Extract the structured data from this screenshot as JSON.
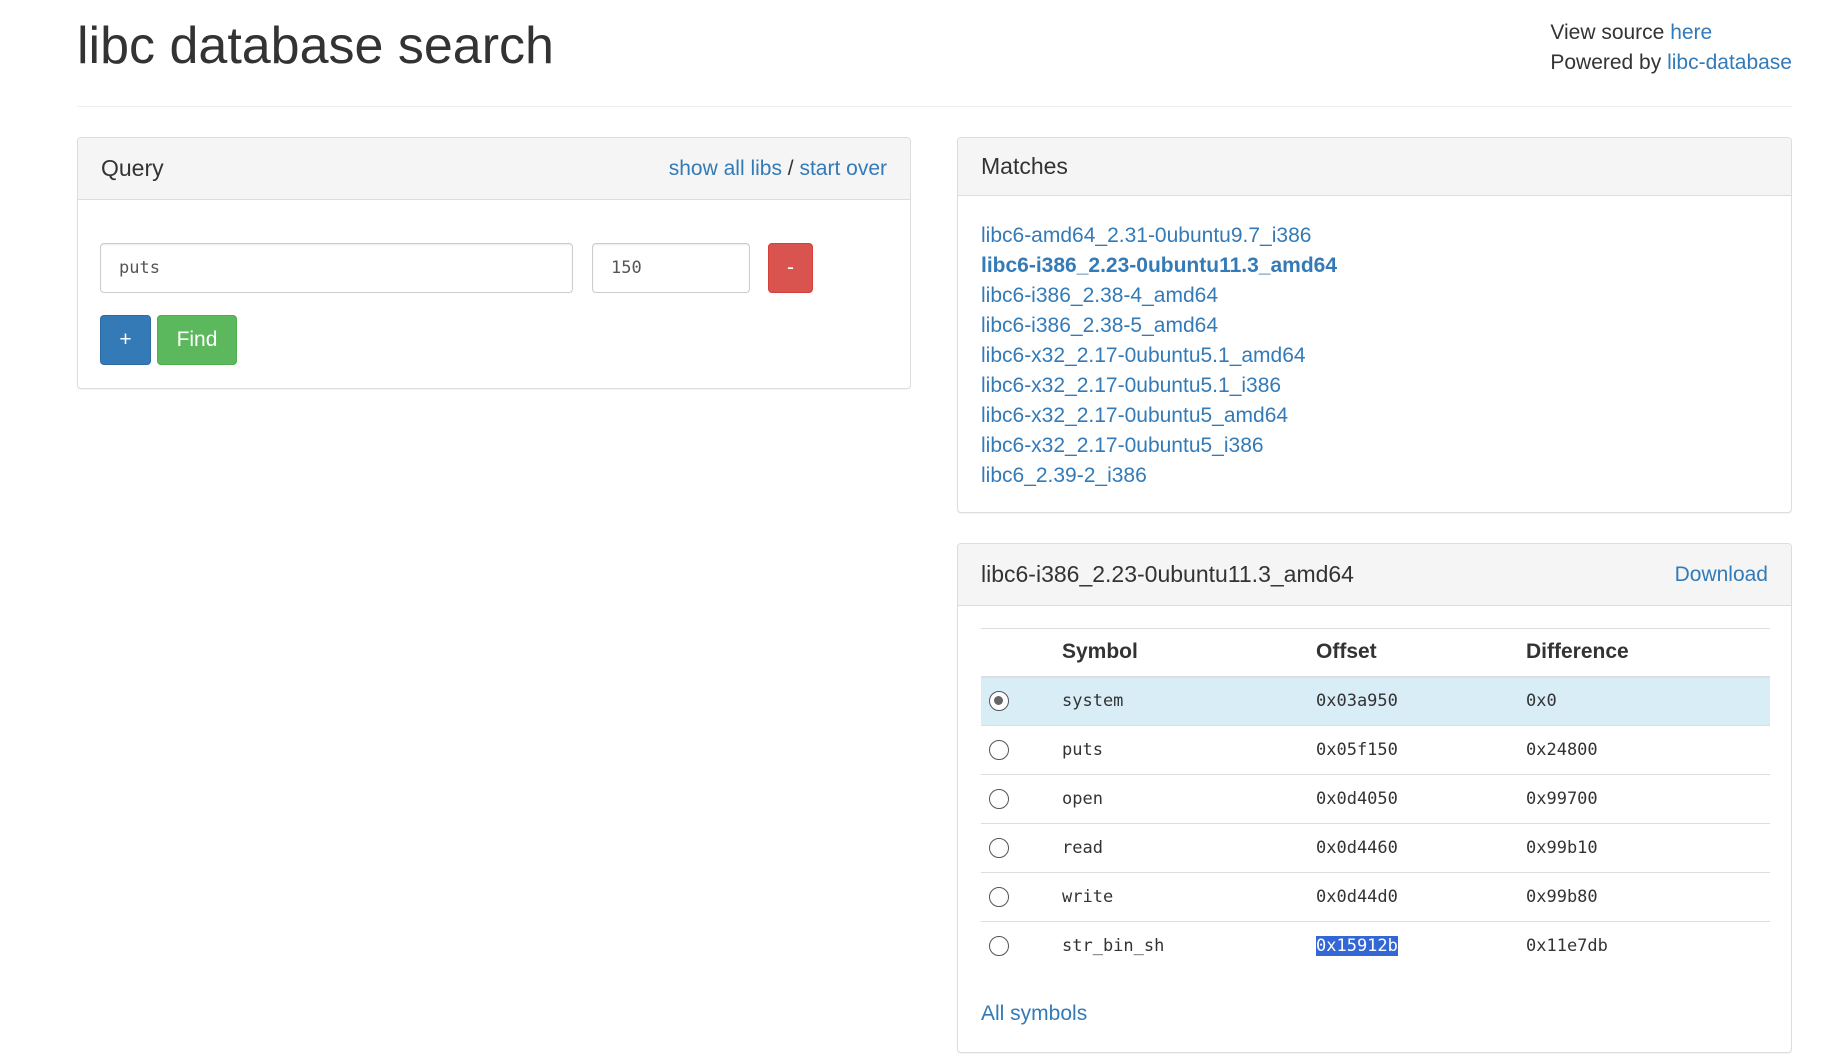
{
  "header": {
    "title": "libc database search",
    "view_source_prefix": "View source ",
    "view_source_link": "here",
    "powered_prefix": "Powered by ",
    "powered_link": "libc-database"
  },
  "query": {
    "title": "Query",
    "show_all": "show all libs",
    "separator": " / ",
    "start_over": "start over",
    "symbol_value": "puts",
    "offset_value": "150",
    "remove_label": "-",
    "add_label": "+",
    "find_label": "Find"
  },
  "matches": {
    "title": "Matches",
    "items": [
      "libc6-amd64_2.31-0ubuntu9.7_i386",
      "libc6-i386_2.23-0ubuntu11.3_amd64",
      "libc6-i386_2.38-4_amd64",
      "libc6-i386_2.38-5_amd64",
      "libc6-x32_2.17-0ubuntu5.1_amd64",
      "libc6-x32_2.17-0ubuntu5.1_i386",
      "libc6-x32_2.17-0ubuntu5_amd64",
      "libc6-x32_2.17-0ubuntu5_i386",
      "libc6_2.39-2_i386"
    ],
    "active_index": 1
  },
  "result": {
    "title": "libc6-i386_2.23-0ubuntu11.3_amd64",
    "download": "Download",
    "columns": [
      "Symbol",
      "Offset",
      "Difference"
    ],
    "rows": [
      {
        "symbol": "system",
        "offset": "0x03a950",
        "difference": "0x0"
      },
      {
        "symbol": "puts",
        "offset": "0x05f150",
        "difference": "0x24800"
      },
      {
        "symbol": "open",
        "offset": "0x0d4050",
        "difference": "0x99700"
      },
      {
        "symbol": "read",
        "offset": "0x0d4460",
        "difference": "0x99b10"
      },
      {
        "symbol": "write",
        "offset": "0x0d44d0",
        "difference": "0x99b80"
      },
      {
        "symbol": "str_bin_sh",
        "offset": "0x15912b",
        "difference": "0x11e7db"
      }
    ],
    "selected_row": 0,
    "all_symbols": "All symbols"
  }
}
